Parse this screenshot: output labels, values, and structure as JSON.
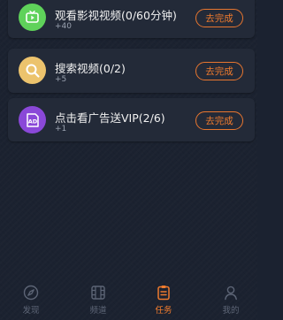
{
  "tasks": [
    {
      "title": "观看影视视频(0/60分钟)",
      "reward": "+40",
      "button_label": "去完成",
      "icon": "tv-play-icon",
      "icon_color": "#5fd25a"
    },
    {
      "title": "搜索视频(0/2)",
      "reward": "+5",
      "button_label": "去完成",
      "icon": "search-icon",
      "icon_color": "#ecc36d"
    },
    {
      "title": "点击看广告送VIP(2/6)",
      "reward": "+1",
      "button_label": "去完成",
      "icon": "ad-icon",
      "icon_color": "#8a48d8"
    }
  ],
  "tabbar": {
    "items": [
      {
        "label": "发现",
        "icon": "compass-icon",
        "active": false
      },
      {
        "label": "频道",
        "icon": "film-icon",
        "active": false
      },
      {
        "label": "任务",
        "icon": "clipboard-icon",
        "active": true
      },
      {
        "label": "我的",
        "icon": "user-icon",
        "active": false
      }
    ]
  },
  "colors": {
    "background": "#1b2230",
    "card": "#232a38",
    "accent": "#ef7b2e",
    "text_primary": "#f1f1f1",
    "text_secondary": "#9aa2b0",
    "tab_inactive": "#5d6576"
  }
}
